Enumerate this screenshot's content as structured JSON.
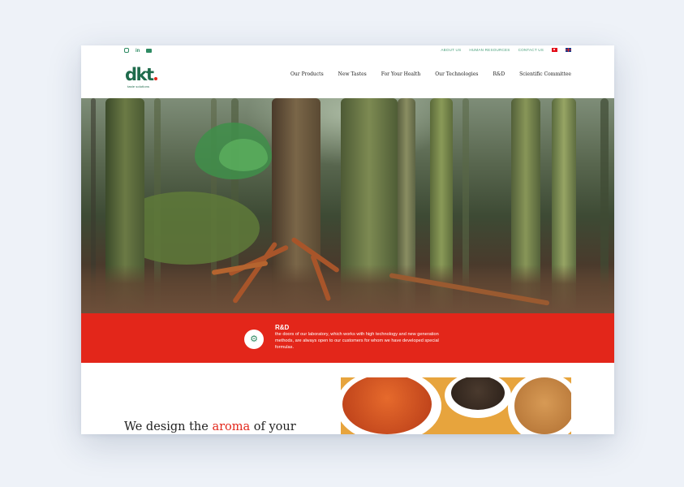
{
  "topbar": {
    "social": [
      "instagram-icon",
      "linkedin-icon",
      "youtube-icon"
    ],
    "linkedin_text": "in",
    "links": [
      "ABOUT US",
      "HUMAN RESOURCES",
      "CONTACT US"
    ]
  },
  "logo": {
    "word": "dkt",
    "tagline": "taste solutions"
  },
  "nav": [
    "Our Products",
    "New Tastes",
    "For Your Health",
    "Our Technologies",
    "R&D",
    "Scientific Committee"
  ],
  "banner": {
    "title": "R&D",
    "description": "the doors of our laboratory, which works with high technology and new generation methods, are always open to our customers for whom we have developed special formulas.",
    "icon": "gear-flask-icon"
  },
  "headline": {
    "before": "We design the ",
    "accent": "aroma",
    "after": " of your"
  },
  "colors": {
    "brand_green": "#1f6b4c",
    "accent_red": "#e3261a"
  }
}
